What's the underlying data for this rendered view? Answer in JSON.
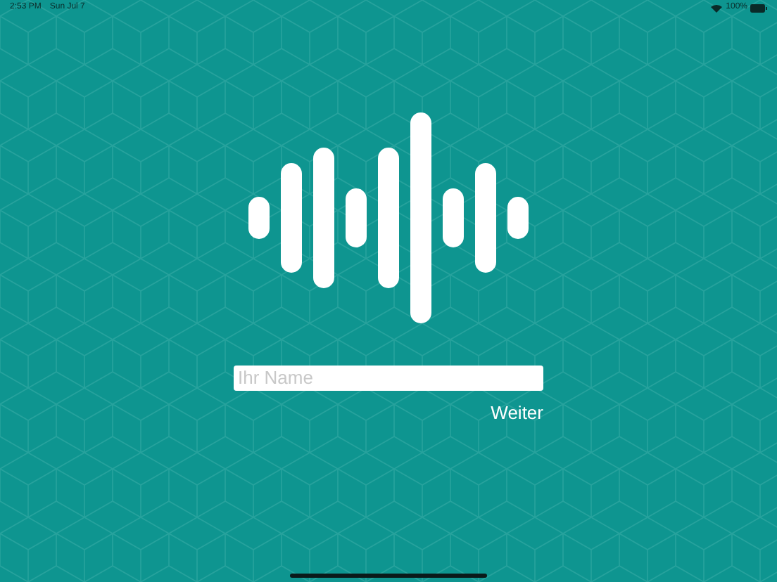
{
  "status_bar": {
    "time": "2:53 PM",
    "date": "Sun Jul 7",
    "battery": "100%"
  },
  "name_field": {
    "placeholder": "Ihr Name"
  },
  "next_button": {
    "label": "Weiter"
  }
}
